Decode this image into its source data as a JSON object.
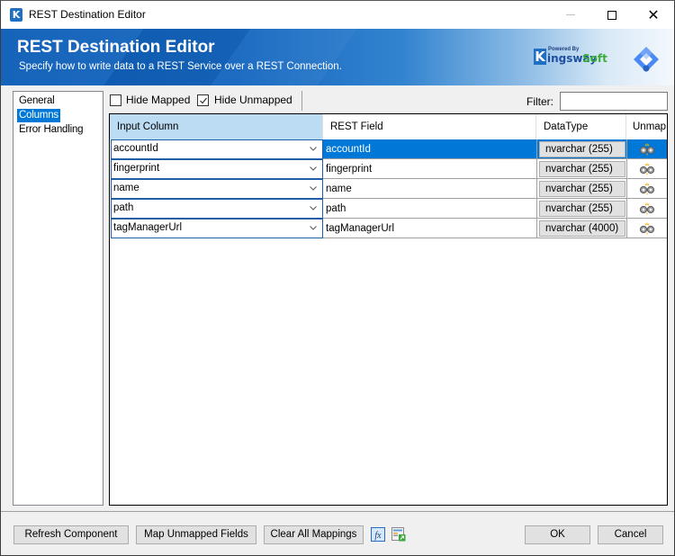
{
  "window": {
    "title": "REST Destination Editor",
    "app_icon_letter": "K"
  },
  "banner": {
    "title": "REST Destination Editor",
    "subtitle": "Specify how to write data to a REST Service over a REST Connection.",
    "logo": {
      "powered_by": "Powered By",
      "k_letter": "K",
      "name_part1": "ingsway",
      "name_part2": "Soft"
    }
  },
  "nav": {
    "items": [
      {
        "label": "General",
        "selected": false
      },
      {
        "label": "Columns",
        "selected": true
      },
      {
        "label": "Error Handling",
        "selected": false
      }
    ]
  },
  "toolbar": {
    "hide_mapped": {
      "label": "Hide Mapped",
      "checked": false
    },
    "hide_unmapped": {
      "label": "Hide Unmapped",
      "checked": true
    },
    "filter_label": "Filter:",
    "filter_value": ""
  },
  "grid": {
    "headers": [
      "Input Column",
      "REST Field",
      "DataType",
      "Unmap"
    ],
    "rows": [
      {
        "input": "accountId",
        "field": "accountId",
        "type": "nvarchar (255)",
        "active": true
      },
      {
        "input": "fingerprint",
        "field": "fingerprint",
        "type": "nvarchar (255)",
        "active": false
      },
      {
        "input": "name",
        "field": "name",
        "type": "nvarchar (255)",
        "active": false
      },
      {
        "input": "path",
        "field": "path",
        "type": "nvarchar (255)",
        "active": false
      },
      {
        "input": "tagManagerUrl",
        "field": "tagManagerUrl",
        "type": "nvarchar (4000)",
        "active": false
      }
    ]
  },
  "buttons": {
    "refresh": "Refresh Component",
    "map_unmapped": "Map Unmapped Fields",
    "clear_all": "Clear All Mappings",
    "ok": "OK",
    "cancel": "Cancel"
  },
  "colors": {
    "accent": "#0078d7",
    "header_selected": "#bcdcf4",
    "banner_blue": "#1566c0"
  }
}
